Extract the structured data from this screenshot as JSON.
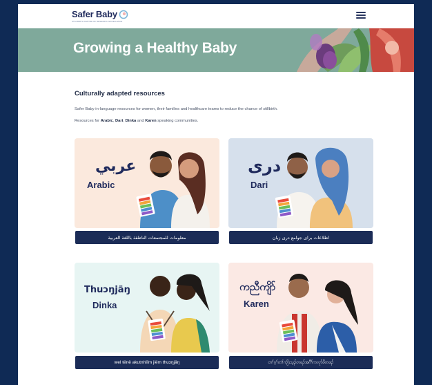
{
  "header": {
    "logo_text": "Safer Baby",
    "logo_subtitle": "STILLBIRTH CENTRE OF RESEARCH EXCELLENCE",
    "menu_icon": "hamburger-menu-icon"
  },
  "hero": {
    "title": "Growing a Healthy Baby"
  },
  "section": {
    "title": "Culturally adapted resources",
    "intro": "Safer Baby in-language resources for women, their families and healthcare teams to reduce the chance of stillbirth.",
    "communities_prefix": "Resources for ",
    "lang1": "Arabic",
    "sep1": ", ",
    "lang2": "Dari",
    "sep2": ", ",
    "lang3": "Dinka",
    "sep3": " and ",
    "lang4": "Karen",
    "communities_suffix": " speaking communities."
  },
  "cards": [
    {
      "script": "عربي",
      "name": "Arabic",
      "button": "معلومات للمجتمعات الناطقة باللغة العربية",
      "bg": "#fbe9dd"
    },
    {
      "script": "دری",
      "name": "Dari",
      "button": "اطلاعات برای جوامع دری زبان",
      "bg": "#d6e0ec"
    },
    {
      "script": "Thuɔŋjäŋ",
      "name": "Dinka",
      "button": "wel tënë akutnhïïm jiëm thuɔŋjäŋ",
      "bg": "#e7f5f3"
    },
    {
      "script": "ကညီကျိာ်",
      "name": "Karen",
      "button": "တၢ်ဂ့ၢ်တၢ်ကျိၤသ့ၣ်တဖၣ်အဂီၢ်ကလုာ်ဖိတဖၣ်",
      "bg": "#fbe9e4"
    }
  ],
  "colors": {
    "background": "#0f2a55",
    "hero": "#7fa99b",
    "button": "#1b2c57",
    "heading": "#1f2a5c"
  }
}
